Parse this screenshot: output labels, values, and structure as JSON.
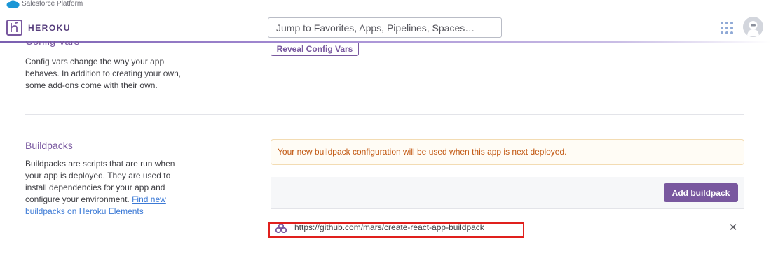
{
  "platform_bar": {
    "label": "Salesforce Platform",
    "icon": "salesforce-cloud-icon"
  },
  "header": {
    "logo_text": "HEROKU",
    "logo_icon": "heroku-logo-icon",
    "search_placeholder": "Jump to Favorites, Apps, Pipelines, Spaces…",
    "apps_icon": "apps-grid-icon",
    "avatar_icon": "user-avatar-icon"
  },
  "config_vars": {
    "title": "Config Vars",
    "description": "Config vars change the way your app behaves. In addition to creating your own, some add-ons come with their own.",
    "reveal_button": "Reveal Config Vars"
  },
  "buildpacks": {
    "title": "Buildpacks",
    "description": "Buildpacks are scripts that are run when your app is deployed. They are used to install dependencies for your app and configure your environment.",
    "link_text": "Find new buildpacks on Heroku Elements",
    "notice": "Your new buildpack configuration will be used when this app is next deployed.",
    "add_button": "Add buildpack",
    "items": [
      {
        "url": "https://github.com/mars/create-react-app-buildpack",
        "icon": "buildpack-icon",
        "remove_label": "✕"
      }
    ]
  },
  "colors": {
    "heroku_purple": "#79589f",
    "notice_text": "#c1560f",
    "highlight_border": "#e0201d",
    "link": "#3c7ad6"
  }
}
